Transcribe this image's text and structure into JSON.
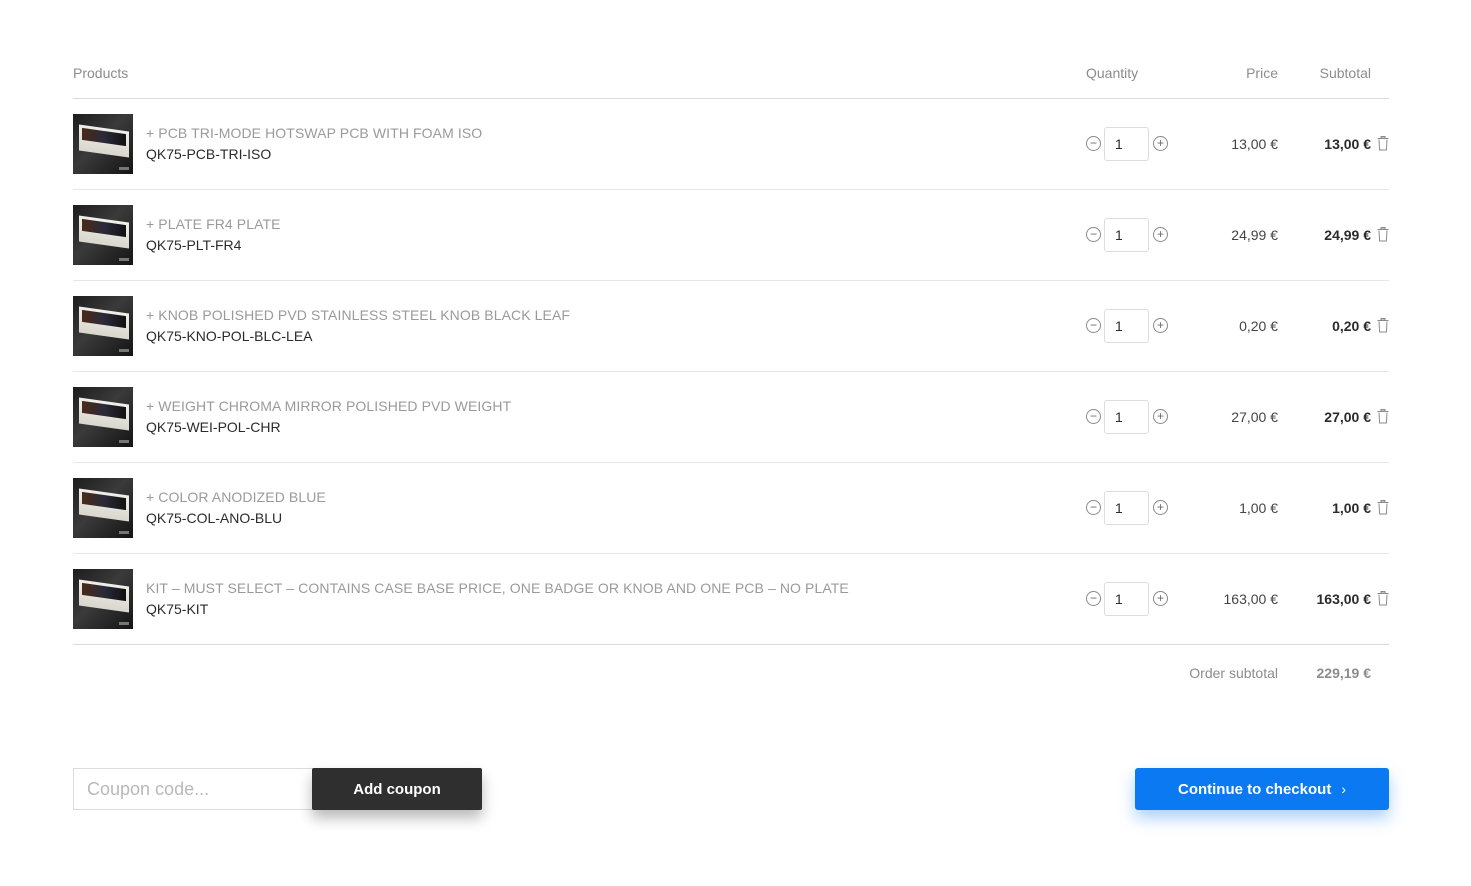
{
  "table": {
    "headers": {
      "products": "Products",
      "quantity": "Quantity",
      "price": "Price",
      "subtotal": "Subtotal"
    },
    "rows": [
      {
        "name": "+ PCB TRI-MODE HOTSWAP PCB WITH FOAM ISO",
        "sku": "QK75-PCB-TRI-ISO",
        "qty": "1",
        "price": "13,00 €",
        "subtotal": "13,00 €"
      },
      {
        "name": "+ PLATE FR4 PLATE",
        "sku": "QK75-PLT-FR4",
        "qty": "1",
        "price": "24,99 €",
        "subtotal": "24,99 €"
      },
      {
        "name": "+ KNOB POLISHED PVD STAINLESS STEEL KNOB BLACK LEAF",
        "sku": "QK75-KNO-POL-BLC-LEA",
        "qty": "1",
        "price": "0,20 €",
        "subtotal": "0,20 €"
      },
      {
        "name": "+ WEIGHT CHROMA MIRROR POLISHED PVD WEIGHT",
        "sku": "QK75-WEI-POL-CHR",
        "qty": "1",
        "price": "27,00 €",
        "subtotal": "27,00 €"
      },
      {
        "name": "+ COLOR ANODIZED BLUE",
        "sku": "QK75-COL-ANO-BLU",
        "qty": "1",
        "price": "1,00 €",
        "subtotal": "1,00 €"
      },
      {
        "name": "KIT – MUST SELECT – CONTAINS CASE BASE PRICE, ONE BADGE OR KNOB AND ONE PCB – NO PLATE",
        "sku": "QK75-KIT",
        "qty": "1",
        "price": "163,00 €",
        "subtotal": "163,00 €"
      }
    ]
  },
  "order_subtotal": {
    "label": "Order subtotal",
    "value": "229,19 €"
  },
  "coupon": {
    "placeholder": "Coupon code...",
    "button_label": "Add coupon"
  },
  "checkout": {
    "label": "Continue to checkout",
    "icon": "chevron-right-icon"
  },
  "icons": {
    "decrease": "minus-circle-icon",
    "increase": "plus-circle-icon",
    "remove": "trash-icon"
  },
  "colors": {
    "accent": "#0a79f2",
    "dark_button": "#2f2f2f",
    "muted_text": "#9a9a9a"
  }
}
